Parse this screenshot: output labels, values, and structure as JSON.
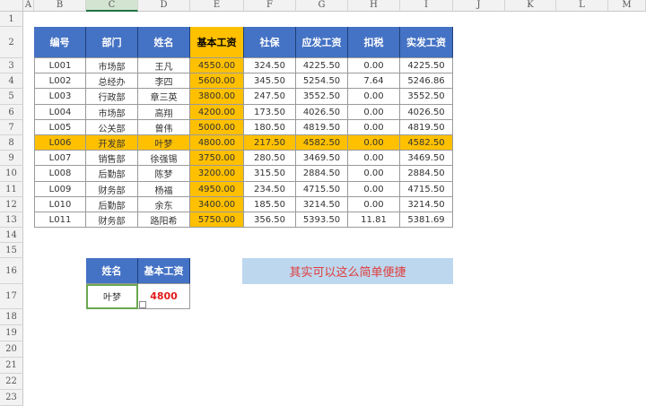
{
  "columns": [
    "A",
    "B",
    "C",
    "D",
    "E",
    "F",
    "G",
    "H",
    "I",
    "J",
    "K",
    "L",
    "M"
  ],
  "rows": [
    "1",
    "2",
    "3",
    "4",
    "5",
    "6",
    "7",
    "8",
    "9",
    "10",
    "11",
    "12",
    "13",
    "14",
    "15",
    "16",
    "17",
    "18",
    "19",
    "20",
    "21",
    "22",
    "23"
  ],
  "table": {
    "headers": [
      "编号",
      "部门",
      "姓名",
      "基本工资",
      "社保",
      "应发工资",
      "扣税",
      "实发工资"
    ],
    "rows": [
      [
        "L001",
        "市场部",
        "王凡",
        "4550.00",
        "324.50",
        "4225.50",
        "0.00",
        "4225.50"
      ],
      [
        "L002",
        "总经办",
        "李四",
        "5600.00",
        "345.50",
        "5254.50",
        "7.64",
        "5246.86"
      ],
      [
        "L003",
        "行政部",
        "章三英",
        "3800.00",
        "247.50",
        "3552.50",
        "0.00",
        "3552.50"
      ],
      [
        "L004",
        "市场部",
        "高翔",
        "4200.00",
        "173.50",
        "4026.50",
        "0.00",
        "4026.50"
      ],
      [
        "L005",
        "公关部",
        "曾伟",
        "5000.00",
        "180.50",
        "4819.50",
        "0.00",
        "4819.50"
      ],
      [
        "L006",
        "开发部",
        "叶梦",
        "4800.00",
        "217.50",
        "4582.50",
        "0.00",
        "4582.50"
      ],
      [
        "L007",
        "销售部",
        "徐强锡",
        "3750.00",
        "280.50",
        "3469.50",
        "0.00",
        "3469.50"
      ],
      [
        "L008",
        "后勤部",
        "陈梦",
        "3200.00",
        "315.50",
        "2884.50",
        "0.00",
        "2884.50"
      ],
      [
        "L009",
        "财务部",
        "杨福",
        "4950.00",
        "234.50",
        "4715.50",
        "0.00",
        "4715.50"
      ],
      [
        "L010",
        "后勤部",
        "余东",
        "3400.00",
        "185.50",
        "3214.50",
        "0.00",
        "3214.50"
      ],
      [
        "L011",
        "财务部",
        "路阳希",
        "5750.00",
        "356.50",
        "5393.50",
        "11.81",
        "5381.69"
      ]
    ],
    "highlight_row": 5
  },
  "lookup": {
    "headers": [
      "姓名",
      "基本工资"
    ],
    "name": "叶梦",
    "result": "4800"
  },
  "note": "其实可以这么简单便捷",
  "colors": {
    "header_blue": "#4472c4",
    "gold": "#ffc000",
    "note_bg": "#bdd7ee",
    "note_text": "#e03c3c"
  }
}
